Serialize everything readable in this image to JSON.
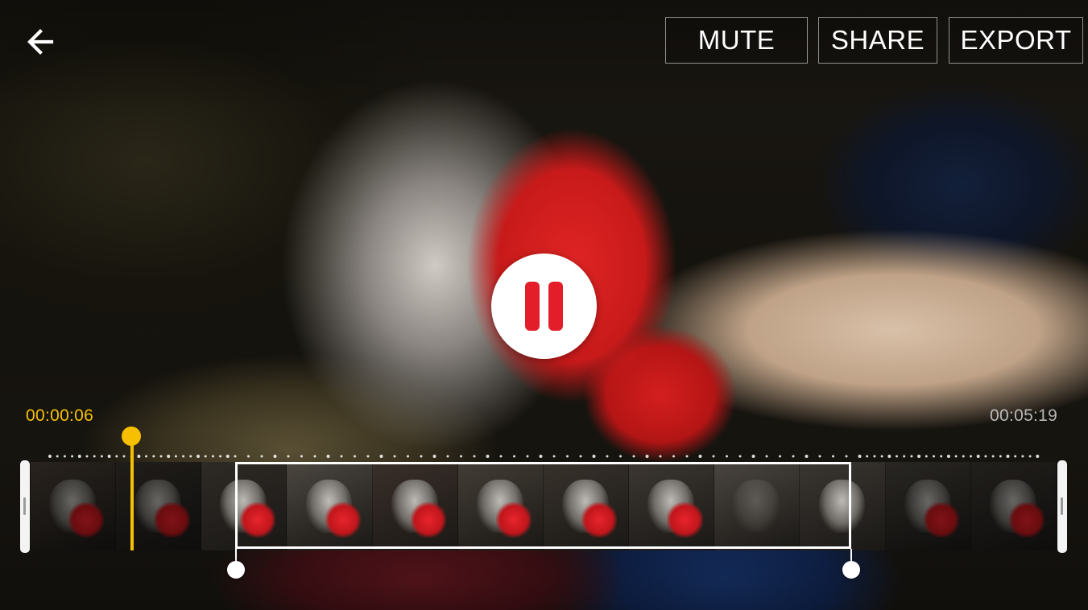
{
  "toolbar": {
    "back_icon": "arrow-left-icon",
    "mute_label": "MUTE",
    "share_label": "SHARE",
    "export_label": "EXPORT"
  },
  "player": {
    "state_icon": "pause-icon",
    "current_time": "00:00:06",
    "total_time": "00:05:19"
  },
  "timeline": {
    "thumbnail_count": 12,
    "colors": {
      "accent": "#f6c000",
      "pause_icon": "#e31e2a",
      "selection": "#ffffff"
    }
  }
}
